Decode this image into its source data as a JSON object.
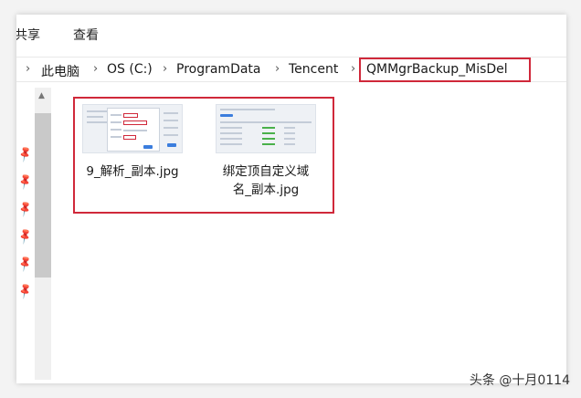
{
  "ribbon": {
    "tabs": [
      "共享",
      "查看"
    ]
  },
  "address": {
    "segments": [
      "此电脑",
      "OS (C:)",
      "ProgramData",
      "Tencent",
      "QMMgrBackup_MisDel"
    ],
    "chevron": "›"
  },
  "files": [
    {
      "name": "9_解析_副本.jpg",
      "thumb": "screenshot-thumbnail"
    },
    {
      "name_line1": "绑定顶自定义域",
      "name_line2": "名_副本.jpg",
      "thumb": "screenshot-thumbnail"
    }
  ],
  "nav": {
    "pins": 6,
    "pin_icon": "pin-icon"
  },
  "watermark": "头条 @十月0114",
  "colors": {
    "highlight": "#d0283a",
    "accent": "#3b7ddd"
  }
}
